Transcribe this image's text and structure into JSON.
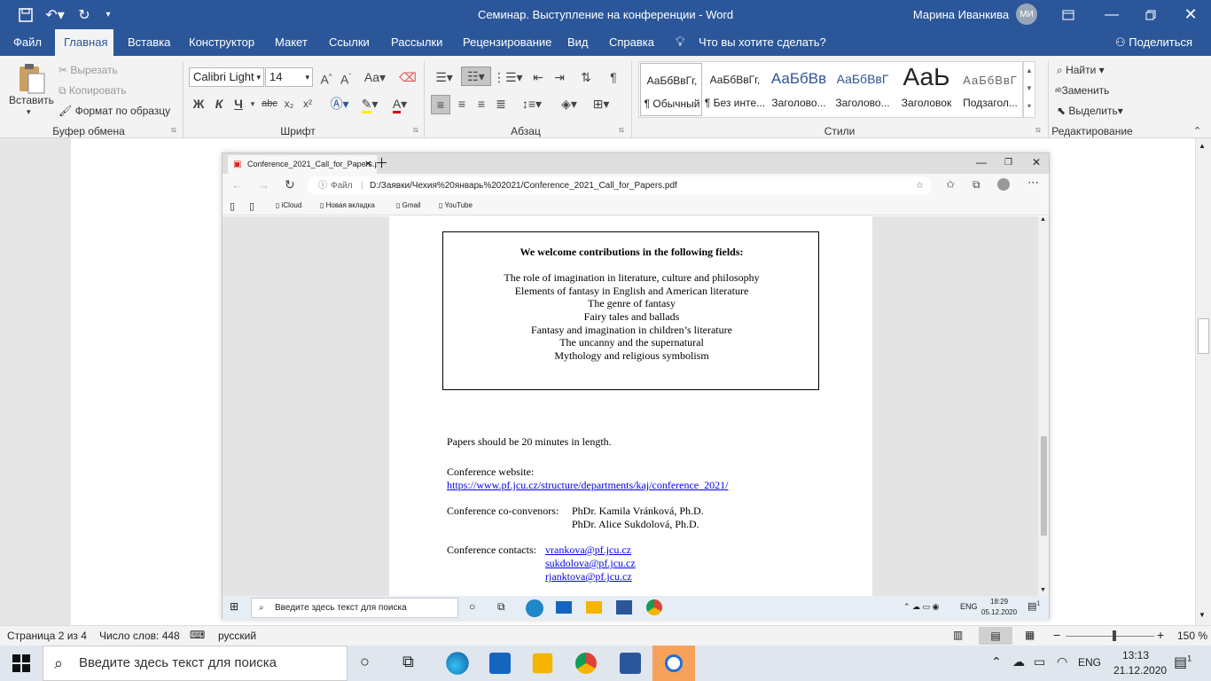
{
  "titlebar": {
    "title": "Семинар. Выступление на конференции  -  Word",
    "user_name": "Марина Иванкива",
    "user_initials": "МИ"
  },
  "tabs": [
    "Файл",
    "Главная",
    "Вставка",
    "Конструктор",
    "Макет",
    "Ссылки",
    "Рассылки",
    "Рецензирование",
    "Вид",
    "Справка"
  ],
  "tell_me": "Что вы хотите сделать?",
  "share": "Поделиться",
  "ribbon": {
    "clipboard": {
      "paste": "Вставить",
      "cut": "Вырезать",
      "copy": "Копировать",
      "format_painter": "Формат по образцу",
      "label": "Буфер обмена"
    },
    "font": {
      "name": "Calibri Light",
      "size": "14",
      "bold": "Ж",
      "italic": "К",
      "underline": "Ч",
      "strike": "abc",
      "sub": "x₂",
      "sup": "x²",
      "label": "Шрифт"
    },
    "paragraph": {
      "label": "Абзац"
    },
    "styles": {
      "items": [
        {
          "preview": "АаБбВвГг,",
          "name": "¶ Обычный"
        },
        {
          "preview": "АаБбВвГг,",
          "name": "¶ Без инте..."
        },
        {
          "preview": "АаБбВв",
          "name": "Заголово..."
        },
        {
          "preview": "АаБбВвГ",
          "name": "Заголово..."
        },
        {
          "preview": "АаЬ",
          "name": "Заголовок"
        },
        {
          "preview": "АаБбВвГ",
          "name": "Подзагол..."
        }
      ],
      "label": "Стили"
    },
    "editing": {
      "find": "Найти",
      "replace": "Заменить",
      "select": "Выделить",
      "label": "Редактирование"
    }
  },
  "browser": {
    "tab_title": "Conference_2021_Call_for_Papers.pdf",
    "addr_scheme": "Файл",
    "addr_url": "D:/Заявки/Чехия%20январь%202021/Conference_2021_Call_for_Papers.pdf",
    "bookmarks": [
      "iCloud",
      "Новая вкладка",
      "Gmail",
      "YouTube"
    ],
    "inner_search": "Введите здесь текст для поиска",
    "inner_lang": "ENG",
    "inner_time": "18:29",
    "inner_date": "05.12.2020",
    "inner_badge": "1"
  },
  "pdf": {
    "fields_heading": "We welcome contributions in the following fields:",
    "fields": [
      "The role of imagination in literature, culture and philosophy",
      "Elements of fantasy in English and American literature",
      "The genre of fantasy",
      "Fairy tales and ballads",
      "Fantasy and imagination in children’s literature",
      "The uncanny and the supernatural",
      "Mythology and religious symbolism"
    ],
    "length": "Papers should be 20 minutes in length.",
    "website_label": "Conference website:",
    "website_url": "https://www.pf.jcu.cz/structure/departments/kaj/conference_2021/",
    "convenors_label": "Conference co-convenors:",
    "convenor1": "PhDr. Kamila Vránková, Ph.D.",
    "convenor2": "PhDr. Alice Sukdolová, Ph.D.",
    "contacts_label": "Conference contacts:",
    "contacts": [
      "vrankova@pf.jcu.cz",
      "sukdolova@pf.jcu.cz",
      "rjanktova@pf.jcu.cz"
    ]
  },
  "status": {
    "page": "Страница 2 из 4",
    "words": "Число слов: 448",
    "lang": "русский",
    "zoom": "150 %"
  },
  "taskbar": {
    "search": "Введите здесь текст для поиска",
    "lang": "ENG",
    "time": "13:13",
    "date": "21.12.2020",
    "badge": "1"
  }
}
